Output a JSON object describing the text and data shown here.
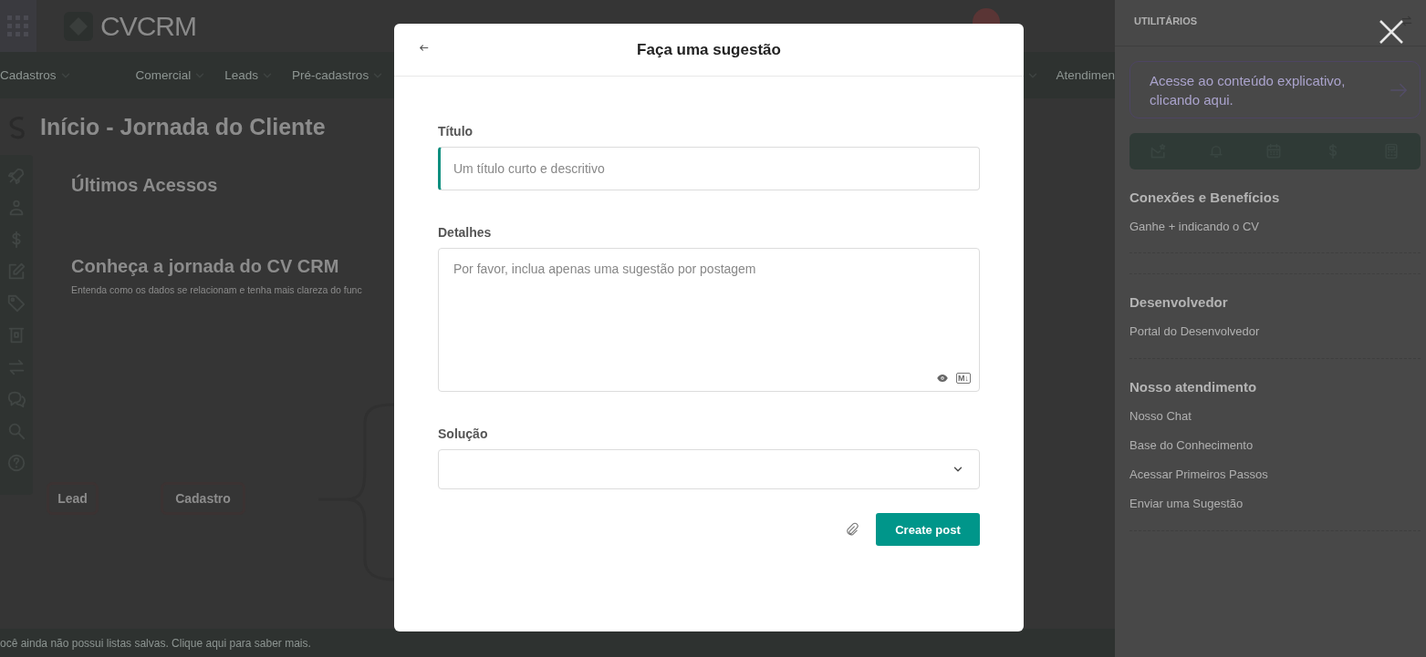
{
  "header": {
    "logo": "**CV**CRM"
  },
  "nav": {
    "items": [
      {
        "label": "Cadastros"
      },
      {
        "label": "Comercial"
      },
      {
        "label": "Leads"
      },
      {
        "label": "Pré-cadastros"
      }
    ],
    "trailing": "Atendimen"
  },
  "page": {
    "title": "Início - Jornada do Cliente",
    "recent_title": "Últimos Acessos",
    "journey_title": "Conheça a jornada do CV CRM",
    "journey_subtitle": "Entenda como os dados se relacionam e tenha mais clareza do func",
    "diagram_nodes": [
      {
        "label": "Lead"
      },
      {
        "label": "Cadastro"
      }
    ]
  },
  "footer": {
    "message": "ocê ainda não possui listas salvas. Clique aqui para saber mais."
  },
  "utilities": {
    "title": "UTILITÁRIOS",
    "help_link": "Acesse ao conteúdo explicativo, clicando aqui.",
    "sections": [
      {
        "title": "Conexões e Benefícios",
        "links": [
          "Ganhe + indicando o CV"
        ]
      },
      {
        "title": "Desenvolvedor",
        "links": [
          "Portal do Desenvolvedor"
        ]
      },
      {
        "title": "Nosso atendimento",
        "links": [
          "Nosso Chat",
          "Base do Conhecimento",
          "Acessar Primeiros Passos",
          "Enviar uma Sugestão"
        ]
      }
    ]
  },
  "modal": {
    "title": "Faça uma sugestão",
    "fields": [
      {
        "kind": "text",
        "label": "Título",
        "placeholder": "Um título curto e descritivo",
        "focused": true
      },
      {
        "kind": "textarea",
        "label": "Detalhes",
        "placeholder": "Por favor, inclua apenas uma sugestão por postagem",
        "focused": false,
        "markdown_badge": "M↓"
      },
      {
        "kind": "select",
        "label": "Solução",
        "focused": false
      }
    ],
    "submit": "Create post"
  }
}
